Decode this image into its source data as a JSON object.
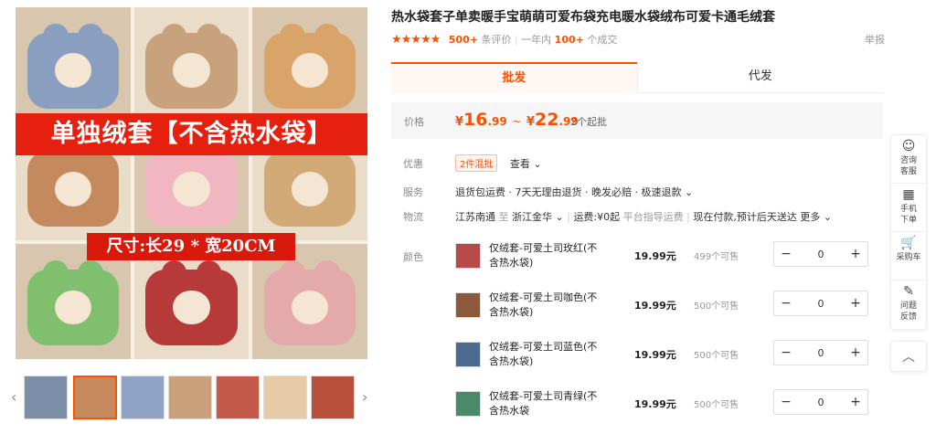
{
  "product": {
    "title": "热水袋套子单卖暖手宝萌萌可爱布袋充电暖水袋绒布可爱卡通毛绒套",
    "stars": "★★★★★",
    "reviews_count": "500+",
    "reviews_label": "条评价",
    "sales_prefix": "一年内",
    "sales_count": "100+",
    "sales_suffix": "个成交",
    "report_label": "举报"
  },
  "gallery": {
    "banner_text": "单独绒套【不含热水袋】",
    "size_text": "尺寸:长29 * 宽20CM",
    "prev_arrow": "‹",
    "next_arrow": "›",
    "colors": [
      "#8a9fbf",
      "#c7a27c",
      "#d9a46a",
      "#c4895c",
      "#f1b6c2",
      "#d2aa78",
      "#7fbf6e",
      "#b63a3a",
      "#e4a9a9"
    ]
  },
  "tabs": [
    {
      "label": "批发",
      "active": true
    },
    {
      "label": "代发",
      "active": false
    }
  ],
  "price": {
    "label": "价格",
    "currency": "¥",
    "min_int": "16",
    "min_dec": ".99",
    "sep": "~",
    "max_int": "22",
    "max_dec": ".99",
    "moq": "2个起批"
  },
  "promo": {
    "label": "优惠",
    "badge": "2件混批",
    "link": "查看 ⌄"
  },
  "service": {
    "label": "服务",
    "text": "退货包运费 · 7天无理由退货 · 晚发必赔 · 极速退款 ⌄"
  },
  "logistics": {
    "label": "物流",
    "from": "江苏南通",
    "to_word": "至",
    "to": "浙江金华 ⌄",
    "fee": "运费:¥0起",
    "guide": "平台指导运费",
    "eta": "现在付款,预计后天送达",
    "more": "更多 ⌄"
  },
  "color_label": "颜色",
  "skus": [
    {
      "name": "仅绒套-可爱土司玫红(不含热水袋)",
      "price": "19.99元",
      "stock": "499个可售",
      "qty": "0",
      "swatch": "#b84a4a"
    },
    {
      "name": "仅绒套-可爱土司咖色(不含热水袋)",
      "price": "19.99元",
      "stock": "500个可售",
      "qty": "0",
      "swatch": "#8a5a3a"
    },
    {
      "name": "仅绒套-可爱土司蓝色(不含热水袋)",
      "price": "19.99元",
      "stock": "500个可售",
      "qty": "0",
      "swatch": "#4a6a8f"
    },
    {
      "name": "仅绒套-可爱土司青绿(不含热水袋",
      "price": "19.99元",
      "stock": "500个可售",
      "qty": "0",
      "swatch": "#4a8a6a"
    }
  ],
  "stepper": {
    "minus": "−",
    "plus": "+"
  },
  "floatbar": [
    {
      "icon": "☺",
      "label1": "咨询",
      "label2": "客服"
    },
    {
      "icon": "▦",
      "label1": "手机",
      "label2": "下单"
    },
    {
      "icon": "🛒",
      "label1": "采购车",
      "label2": ""
    },
    {
      "icon": "✎",
      "label1": "问题",
      "label2": "反馈"
    }
  ],
  "back_top": "︿"
}
